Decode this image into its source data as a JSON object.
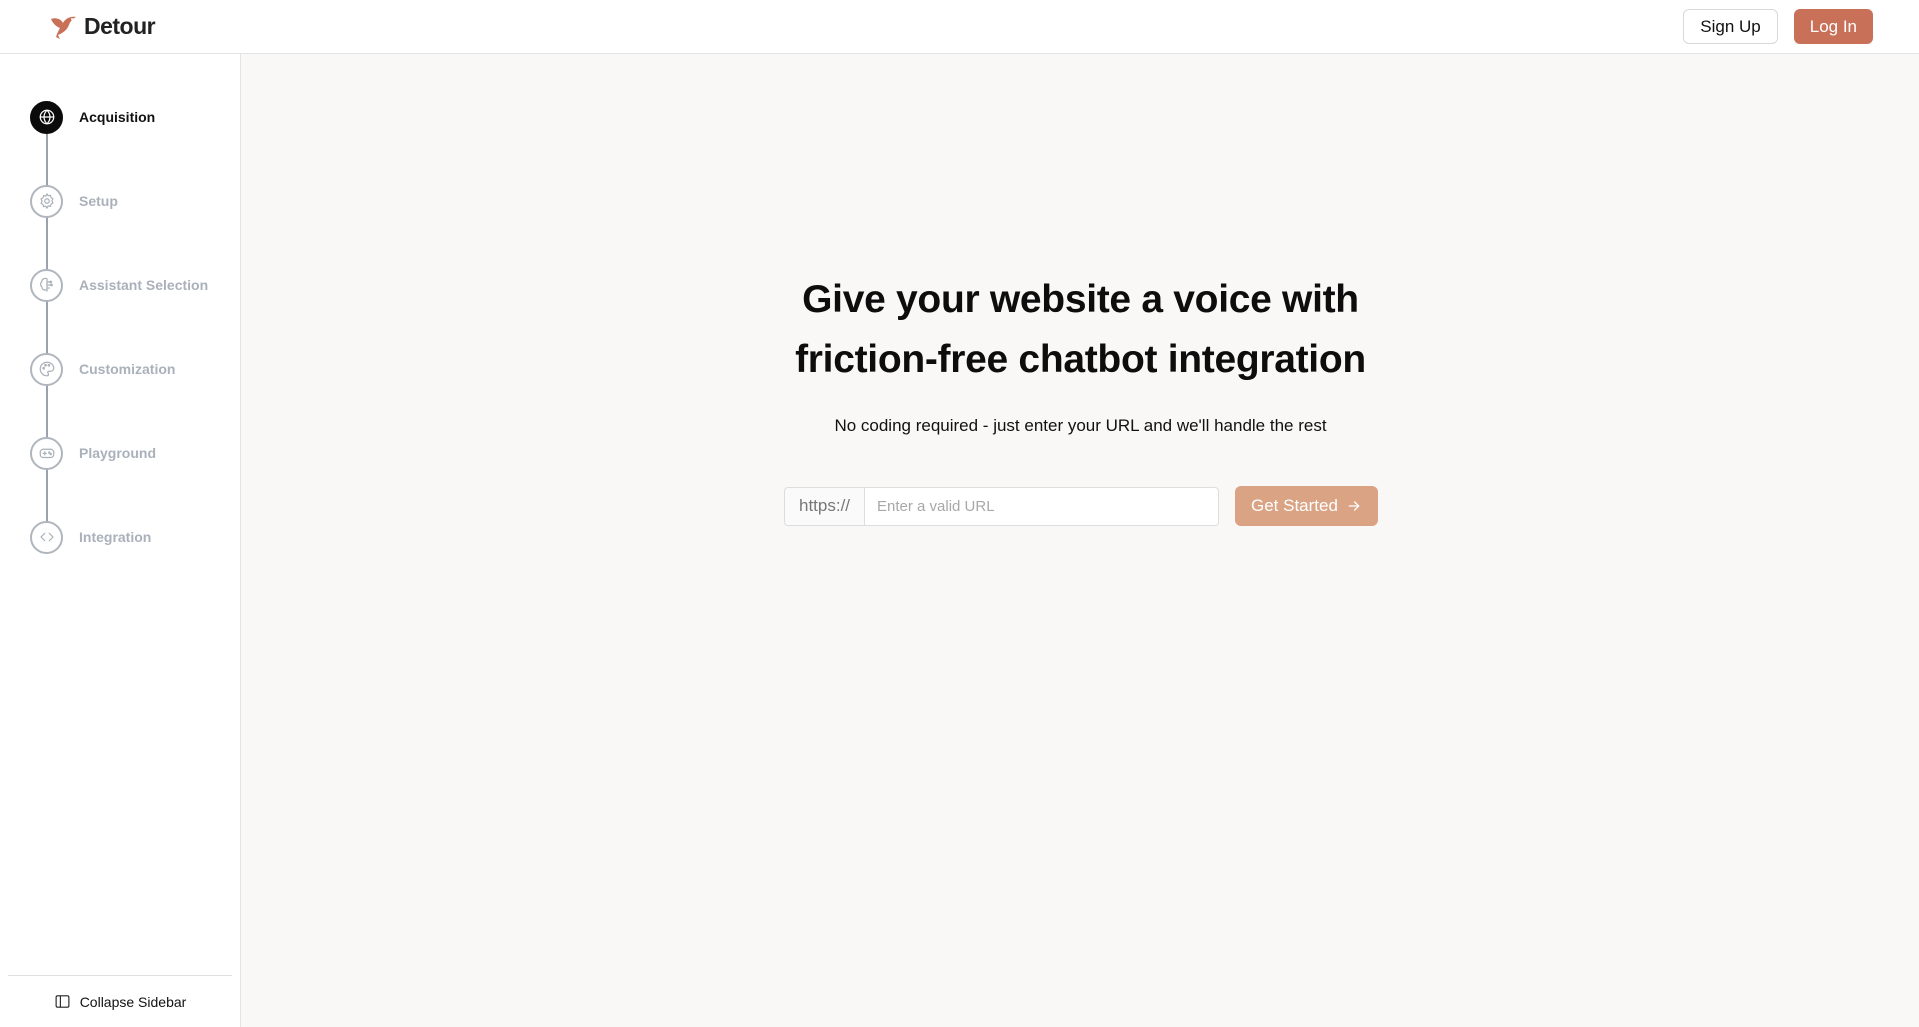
{
  "header": {
    "brand_name": "Detour",
    "signup_label": "Sign Up",
    "login_label": "Log In"
  },
  "sidebar": {
    "steps": [
      {
        "label": "Acquisition",
        "icon": "globe-icon",
        "active": true
      },
      {
        "label": "Setup",
        "icon": "gear-icon",
        "active": false
      },
      {
        "label": "Assistant Selection",
        "icon": "brain-icon",
        "active": false
      },
      {
        "label": "Customization",
        "icon": "palette-icon",
        "active": false
      },
      {
        "label": "Playground",
        "icon": "gamepad-icon",
        "active": false
      },
      {
        "label": "Integration",
        "icon": "code-icon",
        "active": false
      }
    ],
    "collapse_label": "Collapse Sidebar"
  },
  "main": {
    "title_line1": "Give your website a voice with",
    "title_line2": "friction-free chatbot integration",
    "subtitle": "No coding required - just enter your URL and we'll handle the rest",
    "url_prefix": "https://",
    "url_placeholder": "Enter a valid URL",
    "url_value": "",
    "cta_label": "Get Started"
  },
  "colors": {
    "accent": "#c97158",
    "cta_disabled": "#d9a384",
    "background": "#f9f8f6"
  }
}
